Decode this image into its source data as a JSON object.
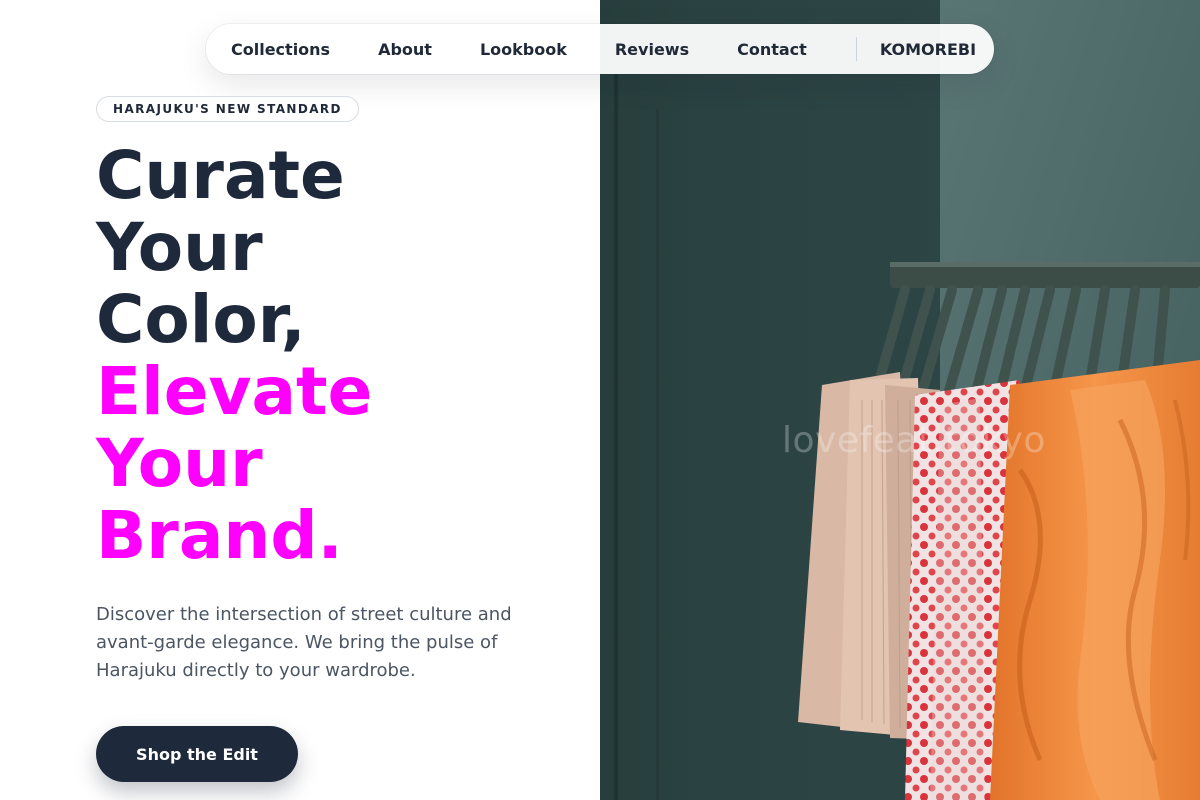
{
  "nav": {
    "items": [
      "Collections",
      "About",
      "Lookbook",
      "Reviews",
      "Contact"
    ],
    "brand": "KOMOREBI"
  },
  "hero": {
    "badge": "HARAJUKU'S NEW STANDARD",
    "headline_lines": [
      "Curate",
      "Your",
      "Color,"
    ],
    "headline_accent_lines": [
      "Elevate",
      "Your",
      "Brand."
    ],
    "description": "Discover the intersection of street culture and avant-garde elegance. We bring the pulse of Harajuku directly to your wardrobe.",
    "cta_label": "Shop the Edit",
    "image_watermark": "lovefeat.tokyo"
  },
  "colors": {
    "ink": "#1e293b",
    "accent": "#ff00ff",
    "body_text": "#4b5563",
    "image_wall": "#3b5756"
  }
}
